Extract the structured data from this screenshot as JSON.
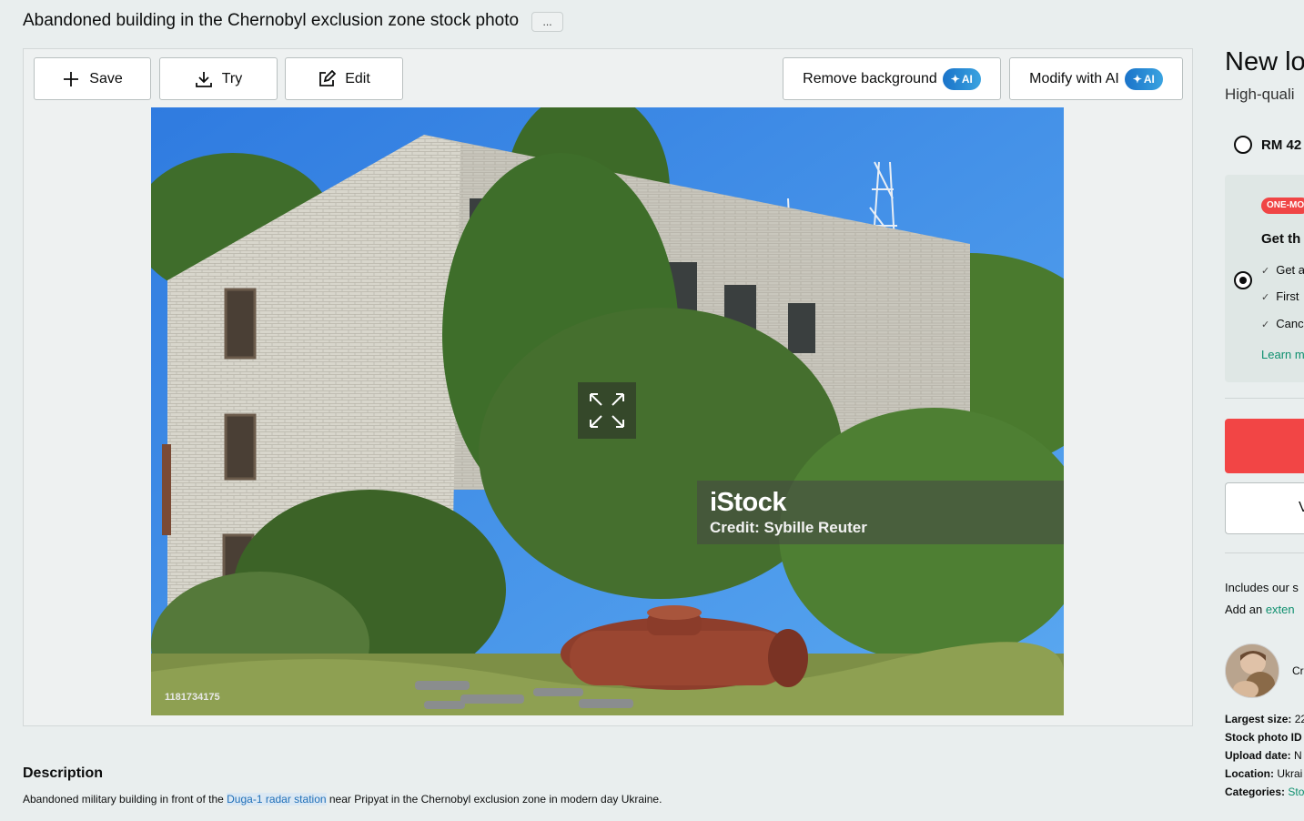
{
  "header": {
    "title": "Abandoned building in the Chernobyl exclusion zone stock photo",
    "more_label": "..."
  },
  "toolbar": {
    "save_label": "Save",
    "try_label": "Try",
    "edit_label": "Edit",
    "remove_bg_label": "Remove background",
    "modify_ai_label": "Modify with AI",
    "ai_badge": "AI"
  },
  "image": {
    "watermark_logo": "iStock",
    "watermark_credit": "Credit: Sybille  Reuter",
    "image_id": "1181734175"
  },
  "description": {
    "heading": "Description",
    "text_before": "Abandoned military building in front of the ",
    "link": "Duga-1 radar station",
    "text_after": " near Pripyat in the Chernobyl exclusion zone in modern day Ukraine."
  },
  "sidebar": {
    "title": "New lo",
    "subtitle": "High-quali",
    "price_option": "RM 42",
    "offer_tag": "ONE-MO",
    "offer_heading": "Get th",
    "features": [
      "Get a",
      "First",
      "Canc"
    ],
    "learn_more": "Learn m",
    "secondary_button": "V",
    "includes_text": "Includes our s",
    "add_text": "Add an ",
    "add_link": "exten",
    "creator": "Cr",
    "meta": [
      {
        "label": "Largest size: ",
        "value": "22",
        "link": false
      },
      {
        "label": "Stock photo ID",
        "value": "",
        "link": false
      },
      {
        "label": "Upload date: ",
        "value": "N",
        "link": false
      },
      {
        "label": "Location: ",
        "value": "Ukrai",
        "link": false
      },
      {
        "label": "Categories: ",
        "value": "Sto",
        "link": true
      }
    ]
  },
  "colors": {
    "accent_red": "#f24545",
    "link_green": "#0e8f6e",
    "ai_blue": "#1a73c9"
  }
}
